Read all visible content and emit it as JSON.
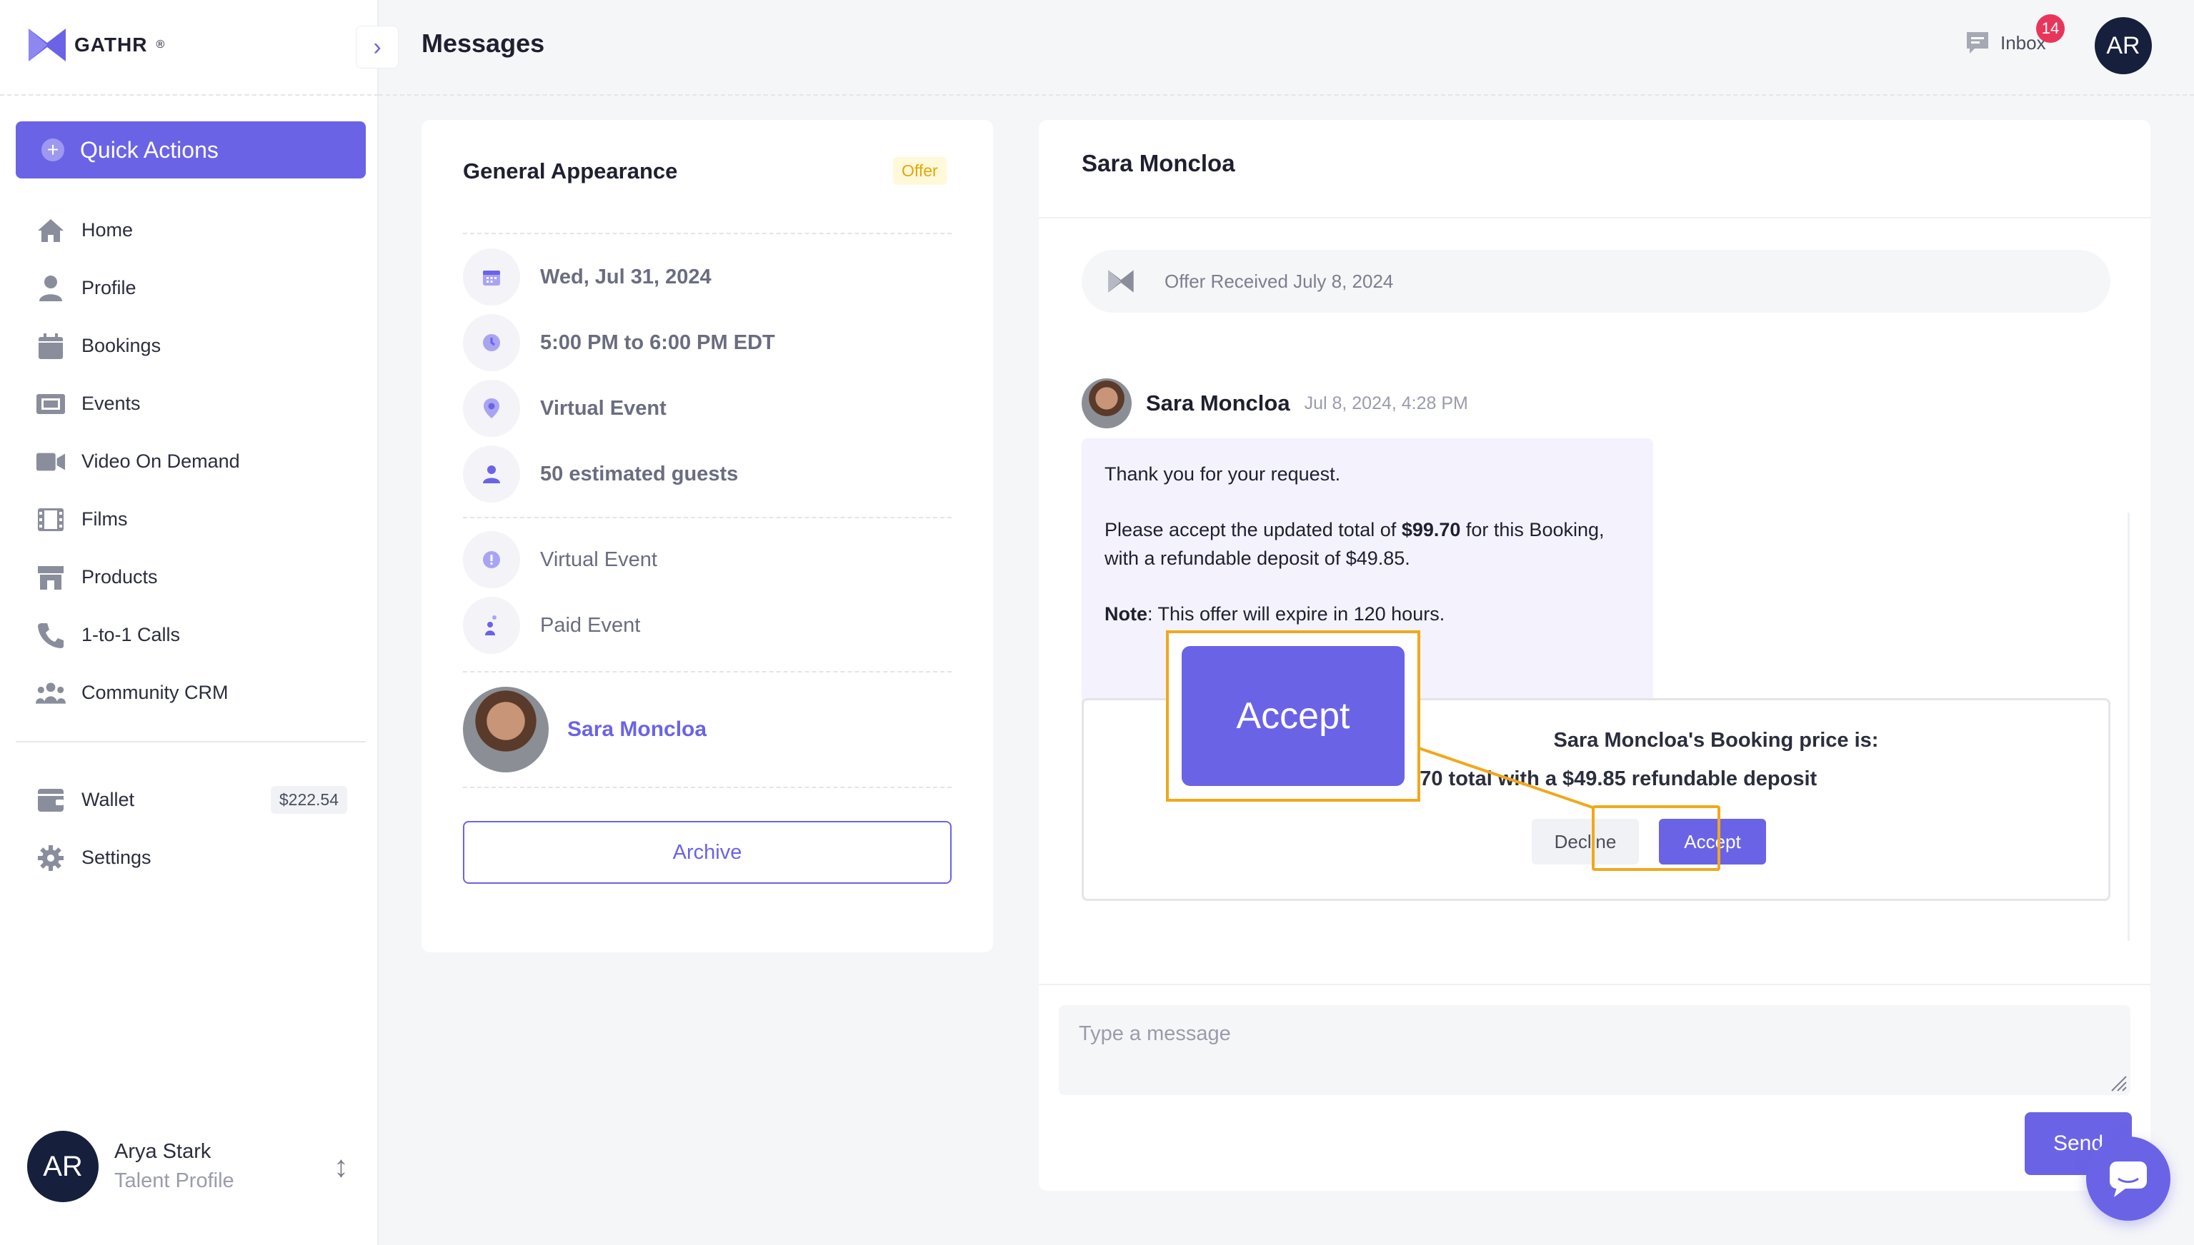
{
  "app": {
    "logo_text": "GATHR",
    "logo_mark": "®",
    "brand_color": "#6b63e6"
  },
  "sidebar": {
    "quick_actions_label": "Quick Actions",
    "nav_items": [
      {
        "label": "Home",
        "icon": "home-icon"
      },
      {
        "label": "Profile",
        "icon": "user-icon"
      },
      {
        "label": "Bookings",
        "icon": "calendar-icon"
      },
      {
        "label": "Events",
        "icon": "ticket-icon"
      },
      {
        "label": "Video On Demand",
        "icon": "video-icon"
      },
      {
        "label": "Films",
        "icon": "film-icon"
      },
      {
        "label": "Products",
        "icon": "store-icon"
      },
      {
        "label": "1-to-1 Calls",
        "icon": "phone-icon"
      },
      {
        "label": "Community CRM",
        "icon": "community-icon"
      }
    ],
    "wallet": {
      "label": "Wallet",
      "amount": "$222.54",
      "icon": "wallet-icon"
    },
    "settings": {
      "label": "Settings",
      "icon": "gear-icon"
    },
    "user": {
      "initials": "AR",
      "name": "Arya Stark",
      "role": "Talent Profile"
    }
  },
  "topbar": {
    "title": "Messages",
    "inbox_label": "Inbox",
    "inbox_count": "14",
    "avatar_initials": "AR"
  },
  "booking_card": {
    "title": "General Appearance",
    "tag": "Offer",
    "date": "Wed, Jul 31, 2024",
    "time": "5:00 PM to 6:00 PM EDT",
    "location": "Virtual Event",
    "guests": "50 estimated guests",
    "event_format": "Virtual Event",
    "event_type": "Paid Event",
    "host_name": "Sara Moncloa",
    "archive_label": "Archive"
  },
  "chat": {
    "header": "Sara Moncloa",
    "offer_received": "Offer Received July 8, 2024",
    "message": {
      "sender": "Sara Moncloa",
      "time": "Jul 8, 2024, 4:28 PM",
      "line1": "Thank you for your request.",
      "line2_prefix": "Please accept the updated total of ",
      "line2_amount": "$99.70",
      "line2_suffix": " for this Booking, with a refundable deposit of $49.85.",
      "note_label": "Note",
      "note_text": ": This offer will expire in 120 hours."
    },
    "booking_price": {
      "title": "Sara Moncloa's Booking price is:",
      "detail": "$99.70 total with a $49.85 refundable deposit",
      "decline_label": "Decline",
      "accept_label": "Accept"
    },
    "zoom_accept_label": "Accept",
    "input_placeholder": "Type a message",
    "send_label": "Send"
  }
}
